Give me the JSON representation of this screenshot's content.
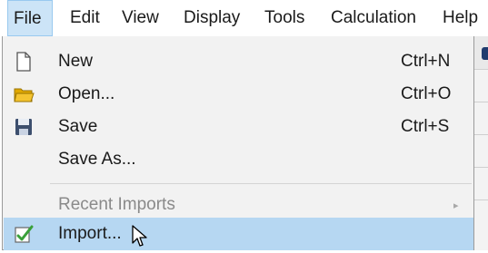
{
  "menubar": {
    "items": [
      "File",
      "Edit",
      "View",
      "Display",
      "Tools",
      "Calculation",
      "Help"
    ],
    "active_index": 0
  },
  "file_menu": {
    "items": [
      {
        "label": "New",
        "shortcut": "Ctrl+N",
        "icon": "new-document-icon",
        "enabled": true
      },
      {
        "label": "Open...",
        "shortcut": "Ctrl+O",
        "icon": "folder-open-icon",
        "enabled": true
      },
      {
        "label": "Save",
        "shortcut": "Ctrl+S",
        "icon": "floppy-disk-icon",
        "enabled": true
      },
      {
        "label": "Save As...",
        "shortcut": "",
        "icon": "",
        "enabled": true
      },
      {
        "label": "Recent Imports",
        "shortcut": "",
        "icon": "",
        "enabled": false,
        "submenu": true
      },
      {
        "label": "Import...",
        "shortcut": "",
        "icon": "import-icon",
        "enabled": true,
        "highlighted": true
      }
    ]
  },
  "colors": {
    "menu_background": "#f2f2f2",
    "highlight": "#b6d7f2",
    "active_title": "#cce4f7",
    "disabled_text": "#8a8a8a",
    "folder_yellow": "#f4c430",
    "import_green": "#3aa03a"
  }
}
